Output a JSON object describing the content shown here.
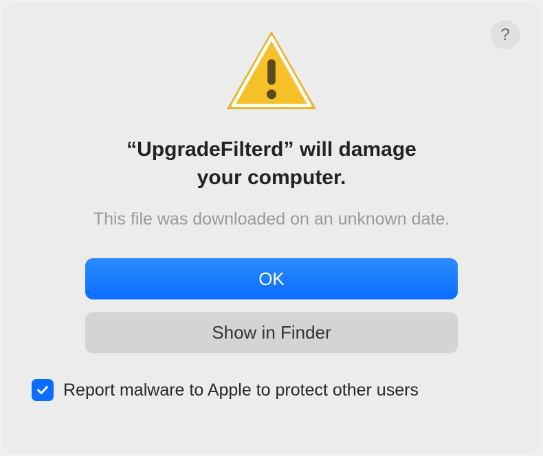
{
  "dialog": {
    "title_line1": "“UpgradeFilterd” will damage",
    "title_line2": "your computer.",
    "subtitle": "This file was downloaded on an unknown date.",
    "help_label": "?",
    "buttons": {
      "primary": "OK",
      "secondary": "Show in Finder"
    },
    "checkbox": {
      "checked": true,
      "label": "Report malware to Apple to protect other users"
    }
  },
  "colors": {
    "primary_accent": "#0a6dff",
    "warning_fill": "#f5c028",
    "dialog_bg": "#ececec"
  }
}
